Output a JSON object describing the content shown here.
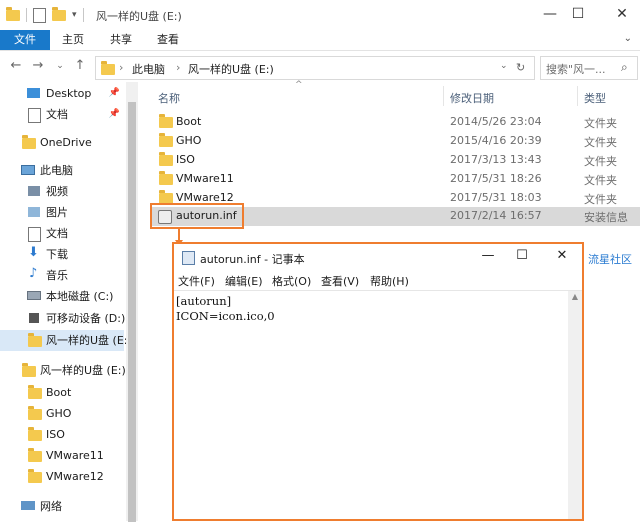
{
  "window": {
    "title": "风一样的U盘 (E:)",
    "minimize": "—",
    "maximize": "☐",
    "close": "✕"
  },
  "ribbon": {
    "tabs": [
      "文件",
      "主页",
      "共享",
      "查看"
    ],
    "expand": "⌄"
  },
  "address": {
    "crumbs": [
      "此电脑",
      "风一样的U盘 (E:)"
    ],
    "search_placeholder": "搜索\"风一..."
  },
  "sidebar": {
    "items": [
      {
        "label": "Desktop",
        "icon": "desktop-icon",
        "pinned": true
      },
      {
        "label": "文档",
        "icon": "document-icon",
        "pinned": true
      },
      {
        "label": "OneDrive",
        "icon": "folder-icon"
      },
      {
        "label": "此电脑",
        "icon": "computer-icon"
      },
      {
        "label": "视频",
        "icon": "video-icon"
      },
      {
        "label": "图片",
        "icon": "picture-icon"
      },
      {
        "label": "文档",
        "icon": "document-icon"
      },
      {
        "label": "下载",
        "icon": "download-icon"
      },
      {
        "label": "音乐",
        "icon": "music-icon"
      },
      {
        "label": "本地磁盘 (C:)",
        "icon": "drive-icon"
      },
      {
        "label": "可移动设备 (D:)",
        "icon": "usb-drive-icon"
      },
      {
        "label": "风一样的U盘 (E:",
        "icon": "usb-drive-icon",
        "selected": true
      },
      {
        "label": "风一样的U盘 (E:)",
        "icon": "usb-drive-icon"
      },
      {
        "label": "Boot",
        "icon": "folder-icon"
      },
      {
        "label": "GHO",
        "icon": "folder-icon"
      },
      {
        "label": "ISO",
        "icon": "folder-icon"
      },
      {
        "label": "VMware11",
        "icon": "folder-icon"
      },
      {
        "label": "VMware12",
        "icon": "folder-icon"
      },
      {
        "label": "网络",
        "icon": "network-icon"
      }
    ]
  },
  "filelist": {
    "headers": {
      "name": "名称",
      "date": "修改日期",
      "type": "类型"
    },
    "rows": [
      {
        "name": "Boot",
        "date": "2014/5/26 23:04",
        "type": "文件夹"
      },
      {
        "name": "GHO",
        "date": "2015/4/16 20:39",
        "type": "文件夹"
      },
      {
        "name": "ISO",
        "date": "2017/3/13 13:43",
        "type": "文件夹"
      },
      {
        "name": "VMware11",
        "date": "2017/5/31 18:26",
        "type": "文件夹"
      },
      {
        "name": "VMware12",
        "date": "2017/5/31 18:03",
        "type": "文件夹"
      },
      {
        "name": "autorun.inf",
        "date": "2017/2/14 16:57",
        "type": "安装信息"
      }
    ]
  },
  "side_text": "流星社区",
  "notepad": {
    "title": "autorun.inf - 记事本",
    "menu": [
      "文件(F)",
      "编辑(E)",
      "格式(O)",
      "查看(V)",
      "帮助(H)"
    ],
    "lines": [
      "[autorun]",
      "ICON=icon.ico,0"
    ]
  },
  "colors": {
    "accent": "#1979ca",
    "highlight_box": "#ef7d2f",
    "folder": "#f4c94e"
  }
}
